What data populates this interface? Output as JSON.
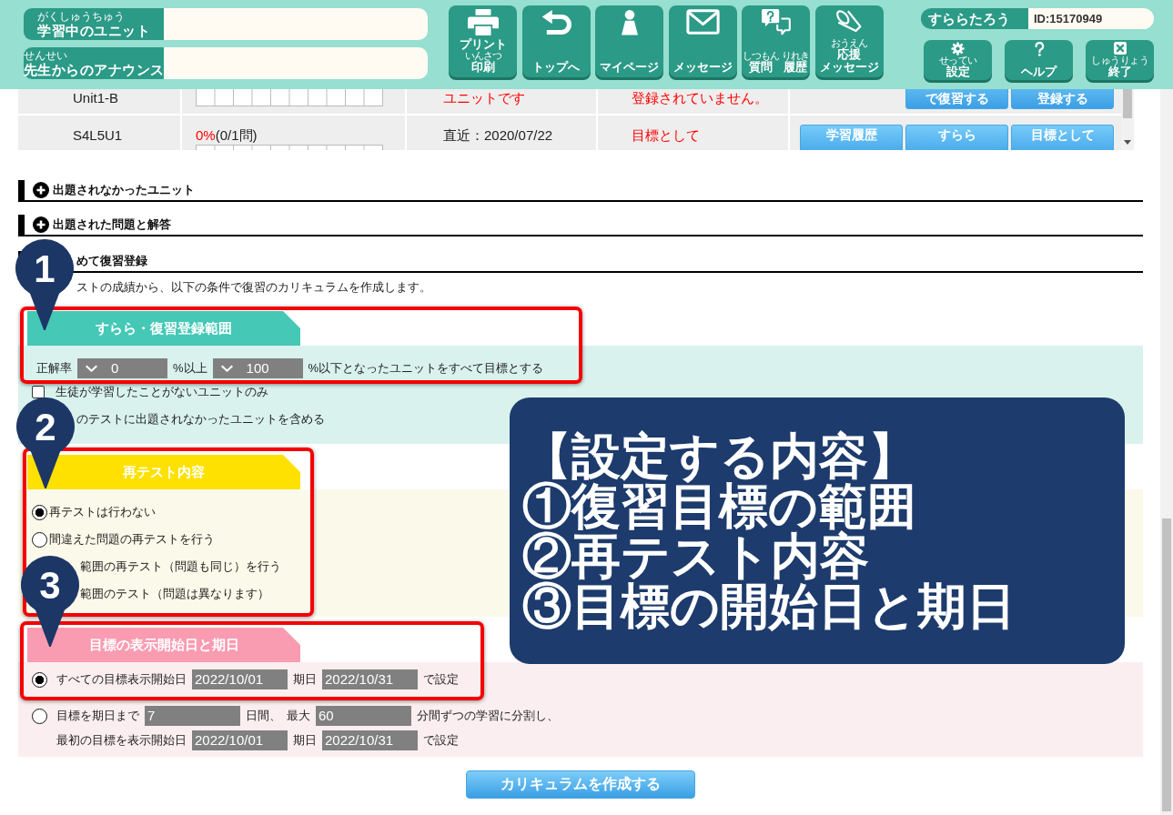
{
  "header": {
    "info_fields": [
      {
        "furigana": "がくしゅうちゅう",
        "label": "学習中のユニット"
      },
      {
        "furigana": "せんせい",
        "label": "先生からのアナウンス"
      }
    ],
    "nav_buttons": [
      {
        "lines": [
          [
            {
              "text": "プリント"
            }
          ],
          [
            {
              "furigana": "いんさつ",
              "text": "印刷"
            }
          ]
        ]
      },
      {
        "lines": [
          [
            {
              "text": "トップへ"
            }
          ]
        ]
      },
      {
        "lines": [
          [
            {
              "text": "マイページ"
            }
          ]
        ]
      },
      {
        "lines": [
          [
            {
              "text": "メッセージ"
            }
          ]
        ]
      },
      {
        "lines": [
          [
            {
              "furigana": "しつもん",
              "text": "質問"
            },
            {
              "furigana": "りれき",
              "text": "履歴"
            }
          ]
        ]
      },
      {
        "lines": [
          [
            {
              "furigana": "おうえん",
              "text": "応援"
            }
          ],
          [
            {
              "text": "メッセージ"
            }
          ]
        ]
      }
    ],
    "user": {
      "name": "すららたろう",
      "id": "ID:15170949"
    },
    "user_buttons": [
      {
        "furigana": "せってい",
        "label": "設定"
      },
      {
        "label": "ヘルプ"
      },
      {
        "furigana": "しゅうりょう",
        "label": "終了"
      }
    ]
  },
  "units_table": {
    "rows": [
      {
        "column_1": [
          "Unit1-B"
        ],
        "column_3": {
          "lines": [
            "ユニットです"
          ],
          "alert": true
        },
        "column_4": [
          "登録されていません。"
        ],
        "column_5": [
          [
            "で復習する"
          ],
          [
            "登録する"
          ]
        ]
      },
      {
        "column_1": [
          "S4L5U1"
        ],
        "column_2": {
          "percent": "0%",
          "count": "(0/1問)"
        },
        "column_3": {
          "lines": [
            "直近：2020/07/22"
          ],
          "alert": false
        },
        "column_4": [
          "目標として"
        ],
        "column_5": [
          [
            "学習履歴"
          ],
          [
            "すらら"
          ],
          [
            "目標として"
          ]
        ]
      }
    ]
  },
  "sections": [
    {
      "title": "出題されなかったユニット",
      "expanded": false
    },
    {
      "title": "出題された問題と解答",
      "expanded": false
    }
  ],
  "review": {
    "title": "めて復習登録",
    "intro": "ストの成績から、以下の条件で復習のカリキュラムを作成します。",
    "range": {
      "tab": "すらら・復習登録範囲",
      "label": "正解率",
      "min": "0",
      "between": "%以上",
      "max": "100",
      "tail": "%以下となったユニットをすべて目標とする",
      "options": [
        {
          "label": "生徒が学習したことがないユニットのみ",
          "checked": false
        },
        {
          "label": "のテストに出題されなかったユニットを含める"
        }
      ]
    },
    "retest": {
      "tab": "再テスト内容",
      "options": [
        {
          "label": "再テストは行わない",
          "selected": true
        },
        {
          "label": "間違えた問題の再テストを行う",
          "selected": false
        },
        {
          "label": "範囲の再テスト（問題も同じ）を行う"
        },
        {
          "label": "範囲のテスト（問題は異なります）"
        }
      ]
    },
    "schedule": {
      "tab": "目標の表示開始日と期日",
      "options": [
        {
          "selected": true,
          "lines": [
            [
              {
                "kind": "text",
                "text": "すべての目標表示開始日"
              },
              {
                "kind": "field",
                "value": "2022/10/01"
              },
              {
                "kind": "text",
                "text": "期日"
              },
              {
                "kind": "field",
                "value": "2022/10/31"
              },
              {
                "kind": "text",
                "text": "で設定"
              }
            ]
          ]
        },
        {
          "selected": false,
          "lines": [
            [
              {
                "kind": "text",
                "text": "目標を期日まで"
              },
              {
                "kind": "field",
                "value": "7"
              },
              {
                "kind": "text",
                "text": "日間、"
              },
              {
                "kind": "text",
                "text": "最大"
              },
              {
                "kind": "field",
                "value": "60"
              },
              {
                "kind": "text",
                "text": "分間ずつの学習に分割し、"
              }
            ],
            [
              {
                "kind": "text",
                "text": "最初の目標を表示開始日"
              },
              {
                "kind": "field",
                "value": "2022/10/01"
              },
              {
                "kind": "text",
                "text": "期日"
              },
              {
                "kind": "field",
                "value": "2022/10/31"
              },
              {
                "kind": "text",
                "text": "で設定"
              }
            ]
          ]
        }
      ]
    },
    "submit": "カリキュラムを作成する"
  },
  "annotations": {
    "pins": [
      "1",
      "2",
      "3"
    ],
    "callout": {
      "title": "【設定する内容】",
      "items": [
        "①復習目標の範囲",
        "②再テスト内容",
        "③目標の開始日と期日"
      ]
    }
  }
}
